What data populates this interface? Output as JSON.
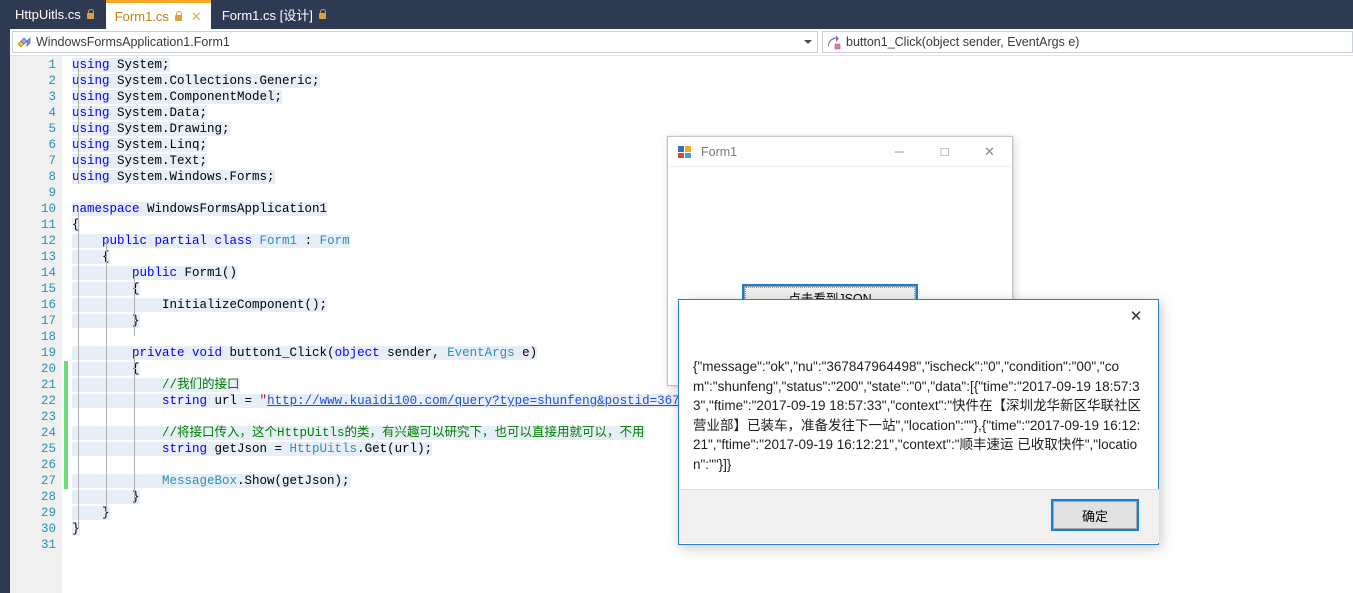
{
  "tabs": [
    {
      "label": "HttpUitls.cs",
      "active": false,
      "locked": true,
      "closable": false
    },
    {
      "label": "Form1.cs",
      "active": true,
      "locked": true,
      "closable": true
    },
    {
      "label": "Form1.cs [设计]",
      "active": false,
      "locked": true,
      "closable": false
    }
  ],
  "tab_close_glyph": "✕",
  "navbar": {
    "class_selector": "WindowsFormsApplication1.Form1",
    "member_selector": "button1_Click(object sender, EventArgs e)",
    "class_icon": "class-icon",
    "member_icon": "method-icon",
    "caret_icon": "chevron-down-icon"
  },
  "editor": {
    "lines": [
      {
        "n": "1",
        "fold": "-",
        "segs": [
          {
            "t": "using ",
            "c": "kw"
          },
          {
            "t": "System;",
            "c": "pln"
          }
        ]
      },
      {
        "n": "2",
        "fold": "",
        "segs": [
          {
            "t": "using ",
            "c": "kw"
          },
          {
            "t": "System.Collections.Generic;",
            "c": "pln"
          }
        ]
      },
      {
        "n": "3",
        "fold": "",
        "segs": [
          {
            "t": "using ",
            "c": "kw"
          },
          {
            "t": "System.ComponentModel;",
            "c": "pln"
          }
        ]
      },
      {
        "n": "4",
        "fold": "",
        "segs": [
          {
            "t": "using ",
            "c": "kw"
          },
          {
            "t": "System.Data;",
            "c": "pln"
          }
        ]
      },
      {
        "n": "5",
        "fold": "",
        "segs": [
          {
            "t": "using ",
            "c": "kw"
          },
          {
            "t": "System.Drawing;",
            "c": "pln"
          }
        ]
      },
      {
        "n": "6",
        "fold": "",
        "segs": [
          {
            "t": "using ",
            "c": "kw"
          },
          {
            "t": "System.Linq;",
            "c": "pln"
          }
        ]
      },
      {
        "n": "7",
        "fold": "",
        "segs": [
          {
            "t": "using ",
            "c": "kw"
          },
          {
            "t": "System.Text;",
            "c": "pln"
          }
        ]
      },
      {
        "n": "8",
        "fold": "",
        "segs": [
          {
            "t": "using ",
            "c": "kw"
          },
          {
            "t": "System.Windows.Forms;",
            "c": "pln"
          }
        ]
      },
      {
        "n": "9",
        "fold": "",
        "segs": []
      },
      {
        "n": "10",
        "fold": "-",
        "segs": [
          {
            "t": "namespace ",
            "c": "kw"
          },
          {
            "t": "WindowsFormsApplication1",
            "c": "pln"
          }
        ]
      },
      {
        "n": "11",
        "fold": "",
        "segs": [
          {
            "t": "{",
            "c": "pln"
          }
        ]
      },
      {
        "n": "12",
        "fold": "-",
        "segs": [
          {
            "t": "    ",
            "c": "pln"
          },
          {
            "t": "public partial class ",
            "c": "kw"
          },
          {
            "t": "Form1",
            "c": "typ"
          },
          {
            "t": " : ",
            "c": "pln"
          },
          {
            "t": "Form",
            "c": "typ"
          }
        ]
      },
      {
        "n": "13",
        "fold": "",
        "segs": [
          {
            "t": "    {",
            "c": "pln"
          }
        ]
      },
      {
        "n": "14",
        "fold": "-",
        "segs": [
          {
            "t": "        ",
            "c": "pln"
          },
          {
            "t": "public ",
            "c": "kw"
          },
          {
            "t": "Form1()",
            "c": "pln"
          }
        ]
      },
      {
        "n": "15",
        "fold": "",
        "segs": [
          {
            "t": "        {",
            "c": "pln"
          }
        ]
      },
      {
        "n": "16",
        "fold": "",
        "segs": [
          {
            "t": "            InitializeComponent();",
            "c": "pln"
          }
        ]
      },
      {
        "n": "17",
        "fold": "",
        "segs": [
          {
            "t": "        }",
            "c": "pln"
          }
        ]
      },
      {
        "n": "18",
        "fold": "",
        "segs": []
      },
      {
        "n": "19",
        "fold": "-",
        "segs": [
          {
            "t": "        ",
            "c": "pln"
          },
          {
            "t": "private void ",
            "c": "kw"
          },
          {
            "t": "button1_Click(",
            "c": "pln"
          },
          {
            "t": "object",
            "c": "kw"
          },
          {
            "t": " sender, ",
            "c": "pln"
          },
          {
            "t": "EventArgs",
            "c": "typ"
          },
          {
            "t": " e)",
            "c": "pln"
          }
        ]
      },
      {
        "n": "20",
        "fold": "",
        "segs": [
          {
            "t": "        {",
            "c": "pln"
          }
        ]
      },
      {
        "n": "21",
        "fold": "",
        "segs": [
          {
            "t": "            ",
            "c": "pln"
          },
          {
            "t": "//我们的接口",
            "c": "cmt"
          }
        ]
      },
      {
        "n": "22",
        "fold": "",
        "segs": [
          {
            "t": "            ",
            "c": "pln"
          },
          {
            "t": "string ",
            "c": "kw"
          },
          {
            "t": "url = ",
            "c": "pln"
          },
          {
            "t": "\"",
            "c": "str"
          },
          {
            "t": "http://www.kuaidi100.com/query?type=shunfeng&postid=36784796",
            "c": "lnk"
          }
        ]
      },
      {
        "n": "23",
        "fold": "",
        "segs": []
      },
      {
        "n": "24",
        "fold": "",
        "segs": [
          {
            "t": "            ",
            "c": "pln"
          },
          {
            "t": "//将接口传入，这个HttpUitls的类，有兴趣可以研究下，也可以直接用就可以，不用",
            "c": "cmt"
          }
        ]
      },
      {
        "n": "25",
        "fold": "",
        "segs": [
          {
            "t": "            ",
            "c": "pln"
          },
          {
            "t": "string ",
            "c": "kw"
          },
          {
            "t": "getJson = ",
            "c": "pln"
          },
          {
            "t": "HttpUitls",
            "c": "typ"
          },
          {
            "t": ".Get(url);",
            "c": "pln"
          }
        ]
      },
      {
        "n": "26",
        "fold": "",
        "segs": []
      },
      {
        "n": "27",
        "fold": "",
        "segs": [
          {
            "t": "            ",
            "c": "pln"
          },
          {
            "t": "MessageBox",
            "c": "typ"
          },
          {
            "t": ".Show(getJson);",
            "c": "pln"
          }
        ]
      },
      {
        "n": "28",
        "fold": "",
        "segs": [
          {
            "t": "        }",
            "c": "pln"
          }
        ]
      },
      {
        "n": "29",
        "fold": "",
        "segs": [
          {
            "t": "    }",
            "c": "pln"
          }
        ]
      },
      {
        "n": "30",
        "fold": "",
        "segs": [
          {
            "t": "}",
            "c": "pln"
          }
        ]
      },
      {
        "n": "31",
        "fold": "",
        "segs": []
      }
    ],
    "change_bar_color": "#6bdd7b",
    "change_bar_start_line": 20,
    "change_bar_end_line": 27
  },
  "form1": {
    "title": "Form1",
    "icon": "windows-forms-icon",
    "minimize_glyph": "─",
    "maximize_glyph": "□",
    "close_glyph": "✕",
    "button_label": "点击看到JSON"
  },
  "messagebox": {
    "close_glyph": "✕",
    "message": "{\"message\":\"ok\",\"nu\":\"367847964498\",\"ischeck\":\"0\",\"condition\":\"00\",\"com\":\"shunfeng\",\"status\":\"200\",\"state\":\"0\",\"data\":[{\"time\":\"2017-09-19 18:57:33\",\"ftime\":\"2017-09-19 18:57:33\",\"context\":\"快件在【深圳龙华新区华联社区营业部】已装车，准备发往下一站\",\"location\":\"\"},{\"time\":\"2017-09-19 16:12:21\",\"ftime\":\"2017-09-19 16:12:21\",\"context\":\"顺丰速运 已收取快件\",\"location\":\"\"}]}",
    "ok_label": "确定"
  },
  "colors": {
    "tabstrip_bg": "#2d3a52",
    "active_tab_accent": "#f5a623",
    "keyword": "#0000ff",
    "type": "#2b91af",
    "comment": "#008000",
    "link": "#1e4fd6",
    "focus_outline": "#1a7fd4"
  }
}
